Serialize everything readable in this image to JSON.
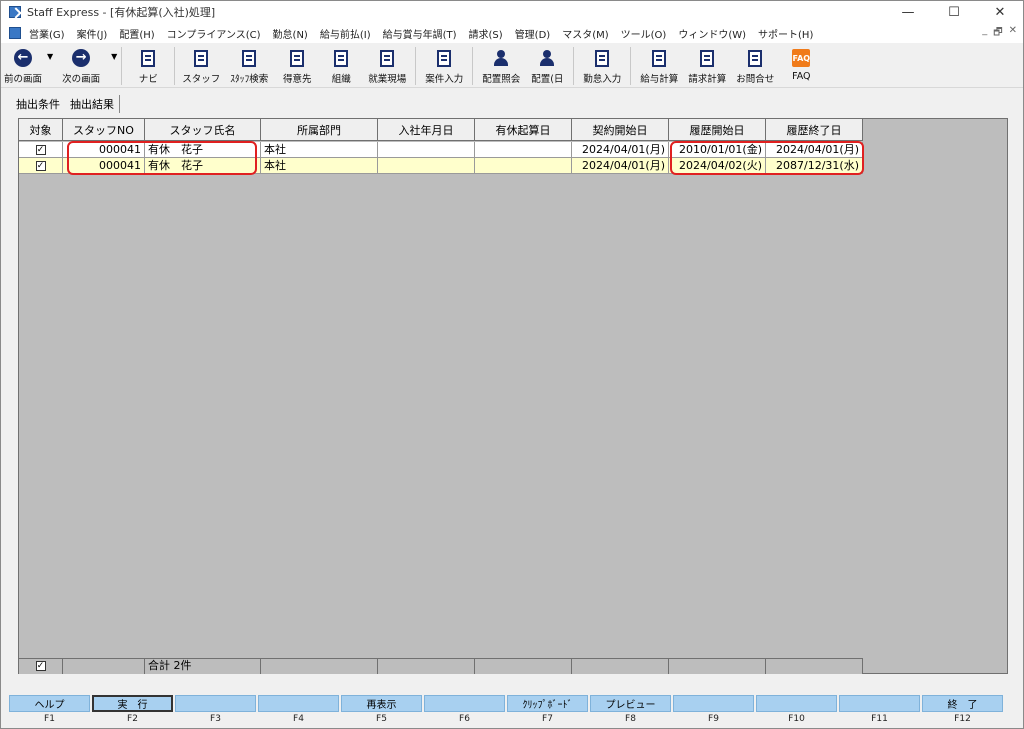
{
  "window": {
    "title": "Staff Express - [有休起算(入社)処理]",
    "controls": [
      "—",
      "☐",
      "✕"
    ]
  },
  "menubar": {
    "items": [
      "営業(G)",
      "案件(J)",
      "配置(H)",
      "コンプライアンス(C)",
      "勤怠(N)",
      "給与前払(I)",
      "給与賞与年調(T)",
      "請求(S)",
      "管理(D)",
      "マスタ(M)",
      "ツール(O)",
      "ウィンドウ(W)",
      "サポート(H)"
    ],
    "mdi_controls": [
      "_",
      "🗗",
      "✕"
    ]
  },
  "toolbar": {
    "items": [
      {
        "label": "前の画面",
        "icon": "arrow-left-icon"
      },
      {
        "label": "次の画面",
        "icon": "arrow-right-icon"
      },
      {
        "label": "ナビ",
        "icon": "navi-icon"
      },
      {
        "label": "スタッフ",
        "icon": "staff-icon"
      },
      {
        "label": "ｽﾀｯﾌ検索",
        "icon": "staff-search-icon"
      },
      {
        "label": "得意先",
        "icon": "customer-icon"
      },
      {
        "label": "組織",
        "icon": "organization-icon"
      },
      {
        "label": "就業現場",
        "icon": "worksite-icon"
      },
      {
        "label": "案件入力",
        "icon": "project-input-icon"
      },
      {
        "label": "配置照会",
        "icon": "placement-inquiry-icon"
      },
      {
        "label": "配置(日",
        "icon": "placement-daily-icon"
      },
      {
        "label": "勤怠入力",
        "icon": "attendance-input-icon"
      },
      {
        "label": "給与計算",
        "icon": "payroll-icon"
      },
      {
        "label": "請求計算",
        "icon": "billing-icon"
      },
      {
        "label": "お問合せ",
        "icon": "inquiry-icon"
      },
      {
        "label": "FAQ",
        "icon": "faq-icon"
      }
    ]
  },
  "tabs": [
    "抽出条件",
    "抽出結果"
  ],
  "grid": {
    "headers": [
      "対象",
      "スタッフNO",
      "スタッフ氏名",
      "所属部門",
      "入社年月日",
      "有休起算日",
      "契約開始日",
      "履歴開始日",
      "履歴終了日"
    ],
    "rows": [
      {
        "checked": "✓",
        "staff_no": "000041",
        "name": "有休　花子",
        "dept": "本社",
        "hire_date": "",
        "leave_start": "",
        "contract_start": "2024/04/01(月)",
        "history_start": "2010/01/01(金)",
        "history_end": "2024/04/01(月)"
      },
      {
        "checked": "✓",
        "staff_no": "000041",
        "name": "有休　花子",
        "dept": "本社",
        "hire_date": "",
        "leave_start": "",
        "contract_start": "2024/04/01(月)",
        "history_start": "2024/04/02(火)",
        "history_end": "2087/12/31(水)"
      }
    ],
    "footer": {
      "checked": "✓",
      "total": "合計 2件"
    }
  },
  "fkeys": [
    {
      "label": "ヘルプ",
      "key": "F1"
    },
    {
      "label": "実　行",
      "key": "F2"
    },
    {
      "label": "",
      "key": "F3"
    },
    {
      "label": "",
      "key": "F4"
    },
    {
      "label": "再表示",
      "key": "F5"
    },
    {
      "label": "",
      "key": "F6"
    },
    {
      "label": "ｸﾘｯﾌﾟﾎﾞｰﾄﾞ",
      "key": "F7"
    },
    {
      "label": "プレビュー",
      "key": "F8"
    },
    {
      "label": "",
      "key": "F9"
    },
    {
      "label": "",
      "key": "F10"
    },
    {
      "label": "",
      "key": "F11"
    },
    {
      "label": "終　了",
      "key": "F12"
    }
  ],
  "colors": {
    "highlight": "#e02020",
    "row_alt": "#ffffcc",
    "fkey": "#a8d0f0",
    "grid_bg": "#bdbdbd"
  }
}
